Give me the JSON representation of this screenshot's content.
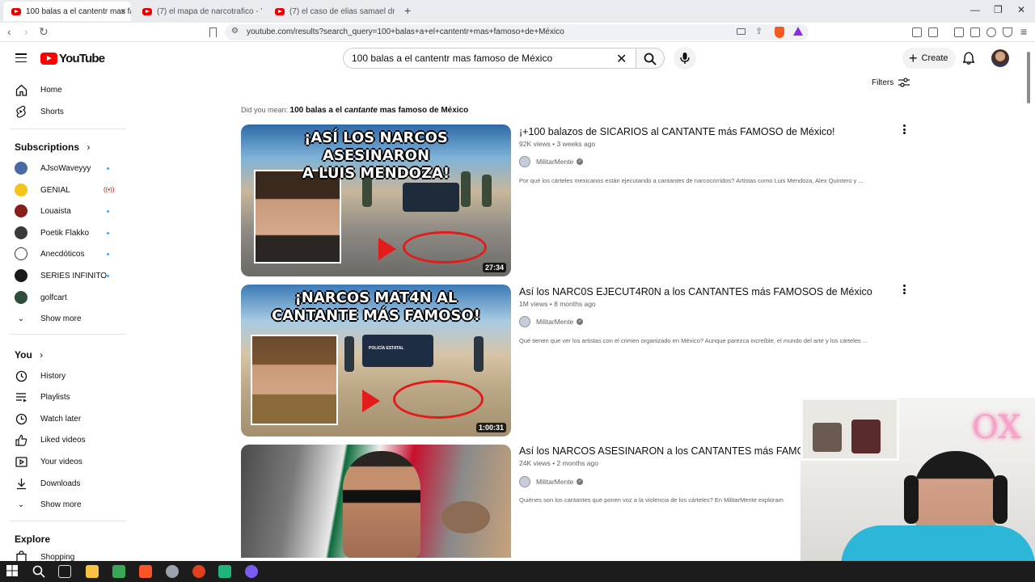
{
  "browser": {
    "tabs": [
      {
        "title": "100 balas a el cantentr mas famo",
        "active": true
      },
      {
        "title": "(7) el mapa de narcotrafico - YouTub",
        "active": false
      },
      {
        "title": "(7) el caso de elias samael dross - Yo",
        "active": false
      }
    ],
    "new_tab": "+",
    "url": "youtube.com/results?search_query=100+balas+a+el+cantentr+mas+famoso+de+México"
  },
  "masthead": {
    "logo_text": "YouTube",
    "search_value": "100 balas a el cantentr mas famoso de México",
    "create_label": "Create"
  },
  "sidebar": {
    "main": [
      {
        "label": "Home",
        "icon": "home-icon"
      },
      {
        "label": "Shorts",
        "icon": "shorts-icon"
      }
    ],
    "subscriptions_heading": "Subscriptions",
    "subscriptions": [
      {
        "label": "AJsoWaveyyy",
        "color": "#4b6aa3",
        "indicator": "dot"
      },
      {
        "label": "GENIAL",
        "color": "#f3c51b",
        "indicator": "live"
      },
      {
        "label": "Louaista",
        "color": "#8a1b1b",
        "indicator": "dot"
      },
      {
        "label": "Poetik Flakko",
        "color": "#3a3a3a",
        "indicator": "dot"
      },
      {
        "label": "Anecdóticos",
        "color": "#ffffff",
        "indicator": "dot"
      },
      {
        "label": "SERIES INFINITO",
        "color": "#1a1a1a",
        "indicator": "dot"
      },
      {
        "label": "golfcart",
        "color": "#2f4d3a",
        "indicator": "none"
      }
    ],
    "subs_show_more": "Show more",
    "you_heading": "You",
    "you_items": [
      {
        "label": "History",
        "icon": "history-icon"
      },
      {
        "label": "Playlists",
        "icon": "playlists-icon"
      },
      {
        "label": "Watch later",
        "icon": "watch-later-icon"
      },
      {
        "label": "Liked videos",
        "icon": "liked-videos-icon"
      },
      {
        "label": "Your videos",
        "icon": "your-videos-icon"
      },
      {
        "label": "Downloads",
        "icon": "downloads-icon"
      }
    ],
    "you_show_more": "Show more",
    "explore_heading": "Explore",
    "explore_items": [
      {
        "label": "Shopping",
        "icon": "shopping-icon"
      }
    ]
  },
  "results": {
    "filters_label": "Filters",
    "did_you_mean_prefix": "Did you mean:",
    "did_you_mean_before": "100 balas a el ",
    "did_you_mean_emph": "cantante",
    "did_you_mean_after": " mas famoso de México",
    "videos": [
      {
        "title": "¡+100 balazos de SICARIOS al CANTANTE más FAMOSO de México!",
        "views": "92K views",
        "age": "3 weeks ago",
        "channel": "MilitarMente",
        "description": "Por qué los cárteles mexicanos están ejecutando a cantantes de narcocorridos? Artistas como Luis Mendoza, Alex Quintero y ...",
        "duration": "27:34",
        "thumb_line1": "¡ASÍ LOS NARCOS ASESINARON",
        "thumb_line2": "A LUIS MENDOZA!"
      },
      {
        "title": "Así los NARC0S EJECUT4R0N a los CANTANTES más FAMOSOS de México",
        "views": "1M views",
        "age": "8 months ago",
        "channel": "MilitarMente",
        "description": "Qué tienen que ver los artistas con el crimen organizado en México? Aunque parezca increíble, el mundo del arte y los cárteles ...",
        "duration": "1:00:31",
        "thumb_line1": "¡NARCOS MAT4N AL",
        "thumb_line2": "CANTANTE MÁS FAMOSO!",
        "thumb_sign": "POLICÍA ESTATAL"
      },
      {
        "title": "Así los NARCOS ASESINARON a los CANTANTES más FAMOSOS",
        "views": "24K views",
        "age": "2 months ago",
        "channel": "MilitarMente",
        "description": "Quiénes son los cantantes que ponen voz a la violencia de los cárteles? En MilitarMente exploram"
      }
    ]
  },
  "overlay": {
    "neon_sign": "OX"
  },
  "colors": {
    "brand": "#ff0000",
    "link_blue": "#3ea6ff",
    "taskbar": "#1c1c1c"
  }
}
